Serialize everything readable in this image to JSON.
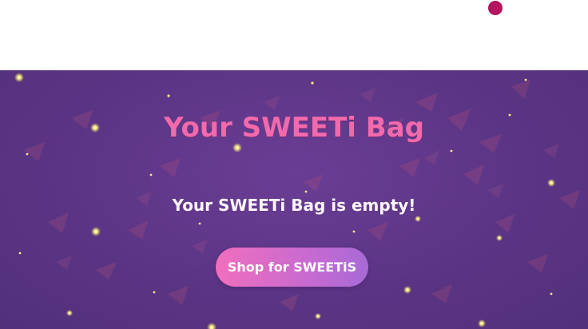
{
  "header": {
    "cart_badge_color": "#b3155e"
  },
  "bag": {
    "title": "Your SWEETi Bag",
    "empty_message": "Your SWEETi Bag is empty!",
    "shop_button_label": "Shop for SWEETiS"
  },
  "colors": {
    "background": "#5b3585",
    "title": "#f26aac",
    "button_start": "#f06fbd",
    "button_end": "#a76ad6"
  }
}
